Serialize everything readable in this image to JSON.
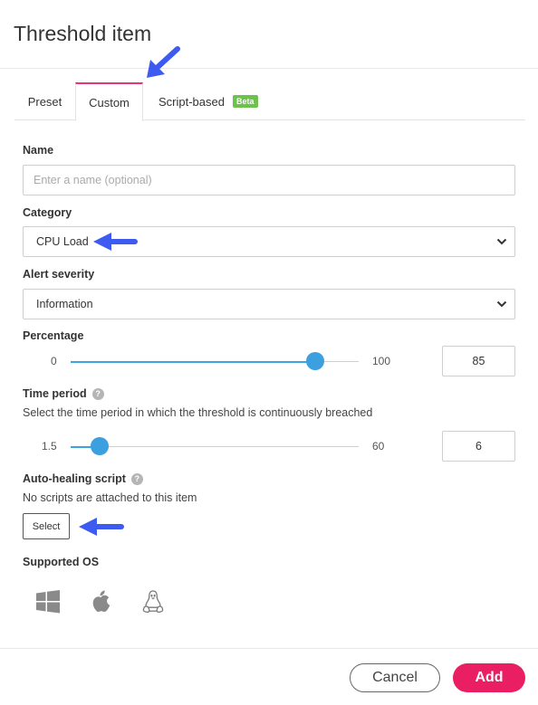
{
  "dialog": {
    "title": "Threshold item"
  },
  "tabs": [
    {
      "label": "Preset"
    },
    {
      "label": "Custom",
      "active": true
    },
    {
      "label": "Script-based",
      "badge": "Beta"
    }
  ],
  "colors": {
    "accent": "#e8346f",
    "slider": "#3b9fe0",
    "badge": "#6cc24a",
    "add_button": "#e91e63",
    "annotation_arrow": "#3d5af1"
  },
  "form": {
    "name": {
      "label": "Name",
      "value": "",
      "placeholder": "Enter a name (optional)"
    },
    "category": {
      "label": "Category",
      "value": "CPU Load"
    },
    "alert_severity": {
      "label": "Alert severity",
      "value": "Information"
    },
    "percentage": {
      "label": "Percentage",
      "min": "0",
      "max": "100",
      "value": "85",
      "fraction": 0.85
    },
    "time_period": {
      "label": "Time period",
      "help": "?",
      "description": "Select the time period in which the threshold is continuously breached",
      "min": "1.5",
      "max": "60",
      "value": "6",
      "fraction": 0.1
    },
    "auto_healing": {
      "label": "Auto-healing script",
      "help": "?",
      "status": "No scripts are attached to this item",
      "button": "Select"
    },
    "supported_os": {
      "label": "Supported OS",
      "icons": [
        "windows-icon",
        "apple-icon",
        "linux-icon"
      ]
    }
  },
  "footer": {
    "cancel": "Cancel",
    "add": "Add"
  }
}
